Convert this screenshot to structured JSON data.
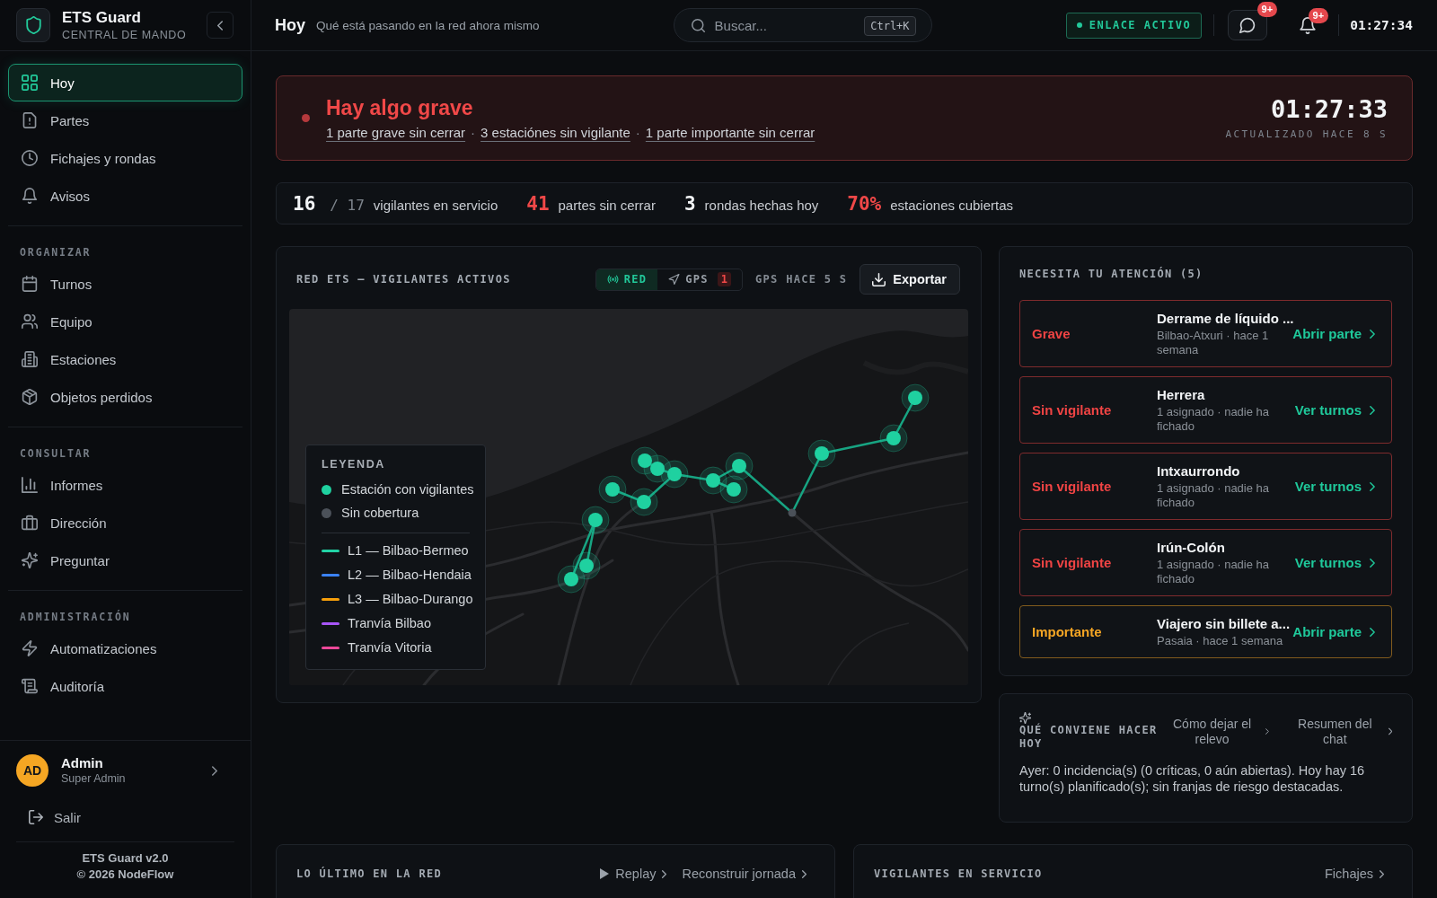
{
  "sidebar": {
    "brand": {
      "title": "ETS Guard",
      "subtitle": "CENTRAL DE MANDO"
    },
    "sections": [
      {
        "items": [
          {
            "label": "Hoy",
            "selected": true
          },
          {
            "label": "Partes",
            "selected": false
          },
          {
            "label": "Fichajes y rondas",
            "selected": false
          },
          {
            "label": "Avisos",
            "selected": false
          }
        ]
      },
      {
        "heading": "ORGANIZAR",
        "items": [
          {
            "label": "Turnos",
            "selected": false
          },
          {
            "label": "Equipo",
            "selected": false
          },
          {
            "label": "Estaciones",
            "selected": false
          },
          {
            "label": "Objetos perdidos",
            "selected": false
          }
        ]
      },
      {
        "heading": "CONSULTAR",
        "items": [
          {
            "label": "Informes",
            "selected": false
          },
          {
            "label": "Dirección",
            "selected": false
          },
          {
            "label": "Preguntar",
            "selected": false
          }
        ]
      },
      {
        "heading": "ADMINISTRACIÓN",
        "items": [
          {
            "label": "Automatizaciones",
            "selected": false
          },
          {
            "label": "Auditoría",
            "selected": false
          }
        ]
      }
    ],
    "user": {
      "initials": "AD",
      "name": "Admin",
      "role": "Super Admin"
    },
    "logout": "Salir",
    "footer": [
      "ETS Guard v2.0",
      "© 2026 NodeFlow"
    ]
  },
  "topbar": {
    "title": "Hoy",
    "subtitle": "Qué está pasando en la red ahora mismo",
    "search": {
      "placeholder": "Buscar...",
      "shortcut": "Ctrl+K"
    },
    "link_status": {
      "label": "ENLACE ACTIVO",
      "active": true
    },
    "messages_badge": "9+",
    "alerts_badge": "9+",
    "clock": "01:27:34"
  },
  "alert": {
    "kind": "critical",
    "title": "Hay algo grave",
    "links": [
      "1 parte grave sin cerrar",
      "3 estaciónes sin vigilante",
      "1 parte importante sin cerrar"
    ],
    "separator": "·",
    "time": "01:27:33",
    "updated": "ACTUALIZADO HACE 8 S"
  },
  "stats": [
    {
      "value": "16",
      "total": "/ 17",
      "label": "vigilantes en servicio",
      "alert": false
    },
    {
      "value": "41",
      "label": "partes sin cerrar",
      "alert": true
    },
    {
      "value": "3",
      "label": "rondas hechas hoy",
      "alert": false
    },
    {
      "value": "70%",
      "label": "estaciones cubiertas",
      "alert": true
    }
  ],
  "map_panel": {
    "title": "RED ETS — VIGILANTES ACTIVOS",
    "modes": [
      {
        "label": "RED",
        "selected": true
      },
      {
        "label": "GPS",
        "selected": false,
        "count": "1"
      }
    ],
    "gps_age": "GPS HACE 5 S",
    "export": "Exportar",
    "legend": {
      "title": "LEYENDA",
      "items": [
        {
          "kind": "dot",
          "label": "Estación con vigilantes",
          "color": "#1fd1a0"
        },
        {
          "kind": "dot",
          "label": "Sin cobertura",
          "color": "#4b5159"
        },
        {
          "kind": "line",
          "label": "L1 — Bilbao-Bermeo",
          "color": "#22d3a6"
        },
        {
          "kind": "line",
          "label": "L2 — Bilbao-Hendaia",
          "color": "#3b82f6"
        },
        {
          "kind": "line",
          "label": "L3 — Bilbao-Durango",
          "color": "#f59e0b"
        },
        {
          "kind": "line",
          "label": "Tranvía Bilbao",
          "color": "#a855f7"
        },
        {
          "kind": "line",
          "label": "Tranvía Vitoria",
          "color": "#ec4899"
        }
      ]
    }
  },
  "attention": {
    "title": "NECESITA TU ATENCIÓN (5)",
    "items": [
      {
        "label": "Grave",
        "color": "#f04444",
        "title": "Derrame de líquido ...",
        "meta": "Bilbao-Atxuri · hace 1 semana",
        "action": "Abrir parte"
      },
      {
        "label": "Sin vigilante",
        "color": "#f04444",
        "title": "Herrera",
        "meta": "1 asignado · nadie ha fichado",
        "action": "Ver turnos"
      },
      {
        "label": "Sin vigilante",
        "color": "#f04444",
        "title": "Intxaurrondo",
        "meta": "1 asignado · nadie ha fichado",
        "action": "Ver turnos"
      },
      {
        "label": "Sin vigilante",
        "color": "#f04444",
        "title": "Irún-Colón",
        "meta": "1 asignado · nadie ha fichado",
        "action": "Ver turnos"
      },
      {
        "label": "Importante",
        "color": "#f5a524",
        "title": "Viajero sin billete a...",
        "meta": "Pasaia · hace 1 semana",
        "action": "Abrir parte"
      }
    ]
  },
  "suggestions": {
    "title": "QUÉ CONVIENE HACER HOY",
    "links": [
      "Cómo dejar el relevo",
      "Resumen del chat"
    ],
    "text": "Ayer: 0 incidencia(s) (0 críticas, 0 aún abiertas). Hoy hay 16 turno(s) planificado(s); sin franjas de riesgo destacadas."
  },
  "bottom_panels": [
    {
      "title": "LO ÚLTIMO EN LA RED",
      "actions": [
        {
          "kind": "play",
          "label": "Replay"
        },
        {
          "kind": "link",
          "label": "Reconstruir jornada"
        }
      ]
    },
    {
      "title": "VIGILANTES EN SERVICIO",
      "actions": [
        {
          "kind": "link",
          "label": "Fichajes"
        }
      ]
    }
  ]
}
